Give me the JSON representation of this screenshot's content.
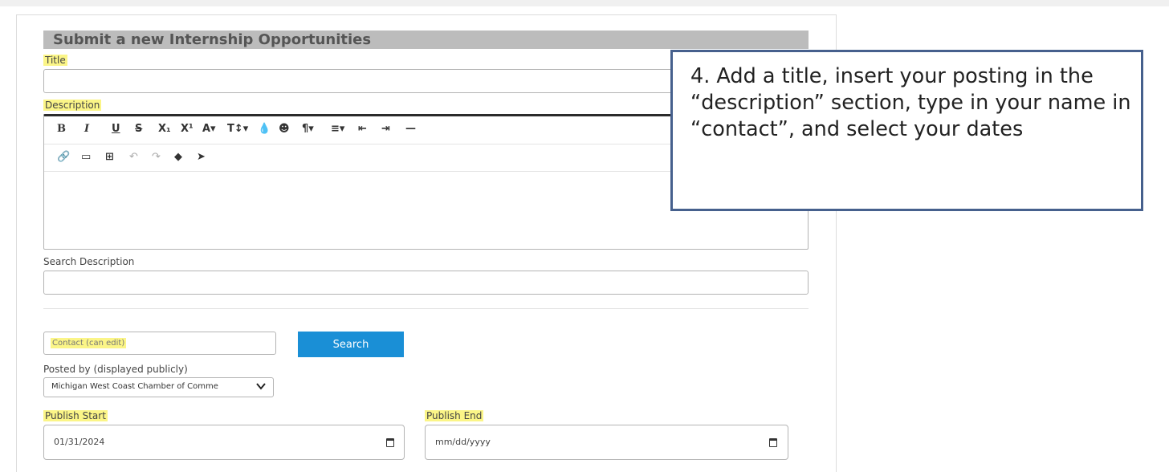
{
  "form": {
    "heading": "Submit a new Internship Opportunities",
    "title_label": "Title",
    "title_value": "",
    "description_label": "Description",
    "description_value": "",
    "search_description_label": "Search Description",
    "search_description_value": "",
    "contact_placeholder": "Contact (can edit)",
    "search_button": "Search",
    "posted_by_label": "Posted by (displayed publicly)",
    "posted_by_value": "Michigan West Coast Chamber of Comme",
    "publish_start_label": "Publish Start",
    "publish_start_value": "01/31/2024",
    "publish_end_label": "Publish End",
    "publish_end_placeholder": "mm/dd/yyyy"
  },
  "toolbar": {
    "row1": [
      {
        "glyph": "B",
        "icon": "bold-icon"
      },
      {
        "glyph": "I",
        "icon": "italic-icon"
      },
      {
        "glyph": "U",
        "icon": "underline-icon"
      },
      {
        "glyph": "S",
        "icon": "strikethrough-icon"
      },
      {
        "glyph": "X₁",
        "icon": "subscript-icon"
      },
      {
        "glyph": "X¹",
        "icon": "superscript-icon"
      },
      {
        "glyph": "A▾",
        "icon": "font-family-icon"
      },
      {
        "glyph": "T↕▾",
        "icon": "font-size-icon"
      },
      {
        "glyph": "💧",
        "icon": "color-icon"
      },
      {
        "glyph": "☻",
        "icon": "emoji-icon"
      },
      {
        "glyph": "¶▾",
        "icon": "paragraph-format-icon"
      },
      {
        "glyph": "≡▾",
        "icon": "align-icon"
      },
      {
        "glyph": "⇤",
        "icon": "outdent-icon"
      },
      {
        "glyph": "⇥",
        "icon": "indent-icon"
      },
      {
        "glyph": "—",
        "icon": "horizontal-rule-icon"
      }
    ],
    "row2": [
      {
        "glyph": "🔗",
        "icon": "link-icon"
      },
      {
        "glyph": "▭",
        "icon": "image-icon"
      },
      {
        "glyph": "⊞",
        "icon": "table-icon"
      },
      {
        "glyph": "↶",
        "icon": "undo-icon"
      },
      {
        "glyph": "↷",
        "icon": "redo-icon"
      },
      {
        "glyph": "◆",
        "icon": "clear-format-icon"
      },
      {
        "glyph": "➤",
        "icon": "select-all-icon"
      }
    ]
  },
  "callout": {
    "text": "4. Add a title, insert your posting in the “description” section, type in your name in “contact”, and select your dates"
  },
  "colors": {
    "highlight": "#fbf587",
    "search_button": "#1a8fd6",
    "callout_border": "#46608d",
    "header_bar": "#bcbcbc"
  }
}
